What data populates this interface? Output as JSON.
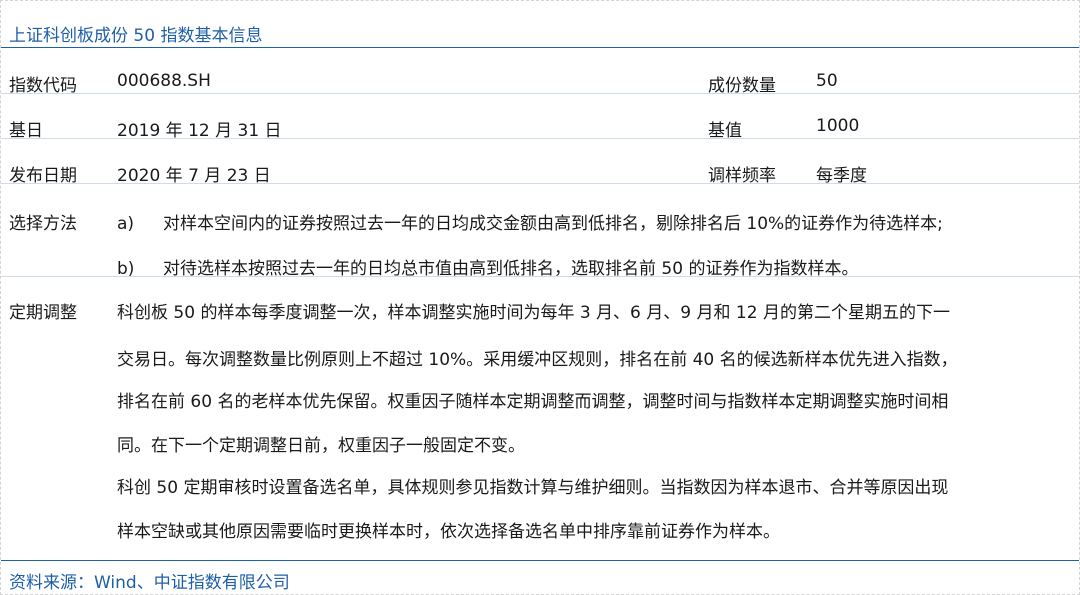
{
  "title": "上证科创板成份 50 指数基本信息",
  "info_rows": [
    {
      "label1": "指数代码",
      "value1": "000688.SH",
      "label2": "成份数量",
      "value2": "50"
    },
    {
      "label1": "基日",
      "value1": "2019 年 12 月 31 日",
      "label2": "基值",
      "value2": "1000"
    },
    {
      "label1": "发布日期",
      "value1": "2020 年 7 月 23 日",
      "label2": "调样频率",
      "value2": "每季度"
    }
  ],
  "selection_method": {
    "label": "选择方法",
    "items": [
      {
        "marker": "a)",
        "text": "对样本空间内的证券按照过去一年的日均成交金额由高到低排名，剔除排名后 10%的证券作为待选样本;"
      },
      {
        "marker": "b)",
        "text": "对待选样本按照过去一年的日均总市值由高到低排名，选取排名前 50 的证券作为指数样本。"
      }
    ]
  },
  "periodic_adjustment": {
    "label": "定期调整",
    "lines": [
      "科创板 50 的样本每季度调整一次，样本调整实施时间为每年 3 月、6 月、9 月和 12 月的第二个星期五的下一",
      "交易日。每次调整数量比例原则上不超过 10%。采用缓冲区规则，排名在前 40 名的候选新样本优先进入指数，",
      "排名在前 60 名的老样本优先保留。权重因子随样本定期调整而调整，调整时间与指数样本定期调整实施时间相",
      "同。在下一个定期调整日前，权重因子一般固定不变。",
      "科创 50 定期审核时设置备选名单，具体规则参见指数计算与维护细则。当指数因为样本退市、合并等原因出现",
      "样本空缺或其他原因需要临时更换样本时，依次选择备选名单中排序靠前证券作为样本。"
    ]
  },
  "source": "资料来源：Wind、中证指数有限公司",
  "colors": {
    "accent_blue": "#1f5fa8",
    "row_divider": "#cfdbe8",
    "text": "#1a1a1a"
  }
}
